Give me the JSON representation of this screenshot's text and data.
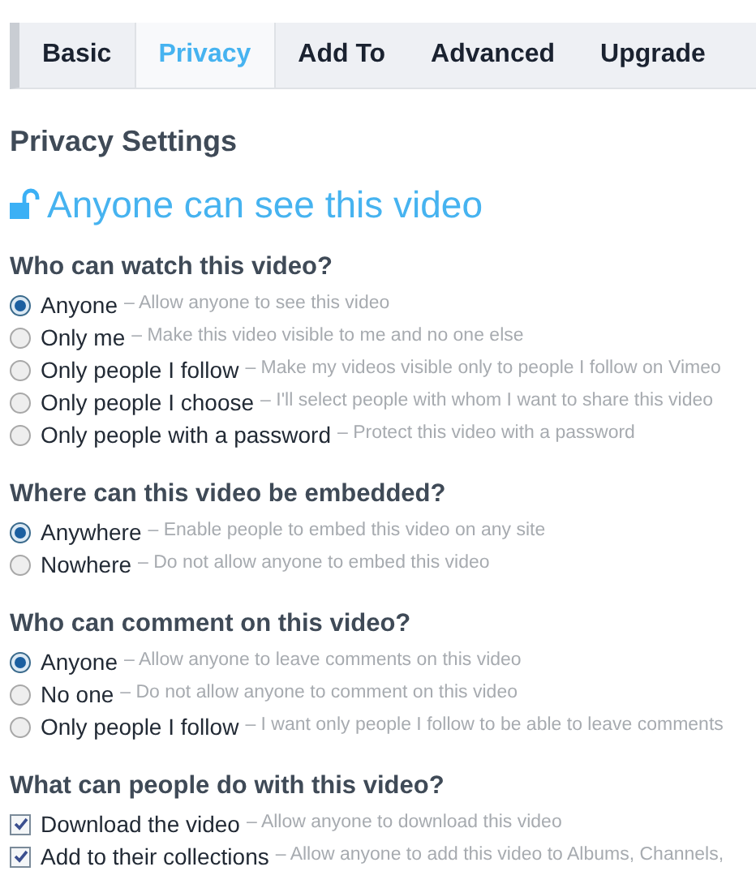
{
  "tabs": [
    {
      "label": "Basic",
      "selected": false
    },
    {
      "label": "Privacy",
      "selected": true
    },
    {
      "label": "Add To",
      "selected": false
    },
    {
      "label": "Advanced",
      "selected": false
    },
    {
      "label": "Upgrade",
      "selected": false
    }
  ],
  "title": "Privacy Settings",
  "status": "Anyone can see this video",
  "sections": [
    {
      "heading": "Who can watch this video?",
      "kind": "radio",
      "options": [
        {
          "label": "Anyone",
          "description": "– Allow anyone to see this video",
          "selected": true
        },
        {
          "label": "Only me",
          "description": "– Make this video visible to me and no one else",
          "selected": false
        },
        {
          "label": "Only people I follow",
          "description": "– Make my videos visible only to people I follow on Vimeo",
          "selected": false
        },
        {
          "label": "Only people I choose",
          "description": "– I'll select people with whom I want to share this video",
          "selected": false
        },
        {
          "label": "Only people with a password",
          "description": "– Protect this video with a password",
          "selected": false
        }
      ]
    },
    {
      "heading": "Where can this video be embedded?",
      "kind": "radio",
      "options": [
        {
          "label": "Anywhere",
          "description": "– Enable people to embed this video on any site",
          "selected": true
        },
        {
          "label": "Nowhere",
          "description": "– Do not allow anyone to embed this video",
          "selected": false
        }
      ]
    },
    {
      "heading": "Who can comment on this video?",
      "kind": "radio",
      "options": [
        {
          "label": "Anyone",
          "description": "– Allow anyone to leave comments on this video",
          "selected": true
        },
        {
          "label": "No one",
          "description": "– Do not allow anyone to comment on this video",
          "selected": false
        },
        {
          "label": "Only people I follow",
          "description": "– I want only people I follow to be able to leave comments",
          "selected": false
        }
      ]
    },
    {
      "heading": "What can people do with this video?",
      "kind": "checkbox",
      "options": [
        {
          "label": "Download the video",
          "description": "– Allow anyone to download this video",
          "checked": true
        },
        {
          "label": "Add to their collections",
          "description": "– Allow anyone to add this video to Albums, Channels,",
          "checked": true
        }
      ]
    }
  ]
}
